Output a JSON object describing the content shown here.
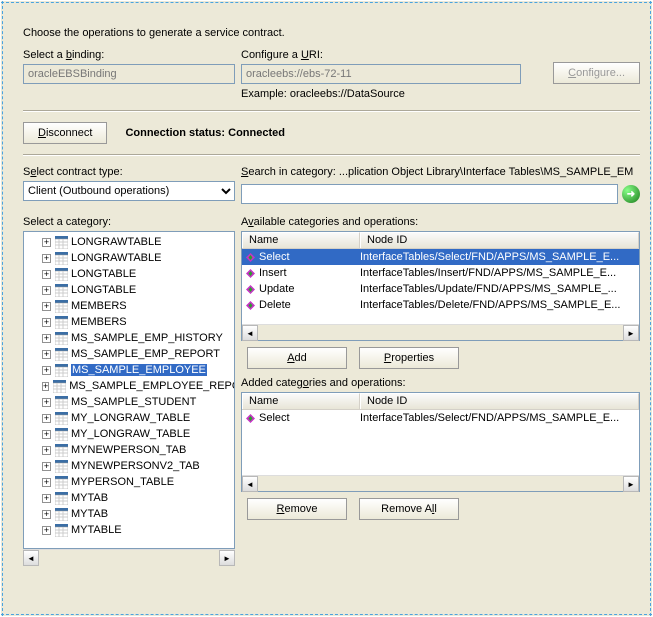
{
  "header": {
    "instruction": "Choose the operations to generate a service contract.",
    "binding_label_pre": "Select a ",
    "binding_label_key": "b",
    "binding_label_post": "inding:",
    "binding_value": "oracleEBSBinding",
    "uri_label_pre": "Configure a ",
    "uri_label_key": "U",
    "uri_label_post": "RI:",
    "uri_value": "oracleebs://ebs-72-11",
    "configure_key": "C",
    "configure_rest": "onfigure...",
    "example": "Example: oracleebs://DataSource"
  },
  "status": {
    "disconnect_key": "D",
    "disconnect_rest": "isconnect",
    "label": "Connection status:",
    "value": "Connected"
  },
  "contract": {
    "label_pre": "S",
    "label_key": "e",
    "label_post": "lect contract type:",
    "value": "Client (Outbound operations)"
  },
  "search": {
    "label_key": "S",
    "label_rest": "earch in category:",
    "path": "...plication Object Library\\Interface Tables\\MS_SAMPLE_EM",
    "value": ""
  },
  "tree": {
    "label_pre": "Select a cate",
    "label_key": "g",
    "label_post": "ory:",
    "items": [
      {
        "label": "LONGRAWTABLE",
        "selected": false
      },
      {
        "label": "LONGRAWTABLE",
        "selected": false
      },
      {
        "label": "LONGTABLE",
        "selected": false
      },
      {
        "label": "LONGTABLE",
        "selected": false
      },
      {
        "label": "MEMBERS",
        "selected": false
      },
      {
        "label": "MEMBERS",
        "selected": false
      },
      {
        "label": "MS_SAMPLE_EMP_HISTORY",
        "selected": false
      },
      {
        "label": "MS_SAMPLE_EMP_REPORT",
        "selected": false
      },
      {
        "label": "MS_SAMPLE_EMPLOYEE",
        "selected": true
      },
      {
        "label": "MS_SAMPLE_EMPLOYEE_REPO",
        "selected": false
      },
      {
        "label": "MS_SAMPLE_STUDENT",
        "selected": false
      },
      {
        "label": "MY_LONGRAW_TABLE",
        "selected": false
      },
      {
        "label": "MY_LONGRAW_TABLE",
        "selected": false
      },
      {
        "label": "MYNEWPERSON_TAB",
        "selected": false
      },
      {
        "label": "MYNEWPERSONV2_TAB",
        "selected": false
      },
      {
        "label": "MYPERSON_TABLE",
        "selected": false
      },
      {
        "label": "MYTAB",
        "selected": false
      },
      {
        "label": "MYTAB",
        "selected": false
      },
      {
        "label": "MYTABLE",
        "selected": false
      }
    ]
  },
  "available": {
    "label_pre": "A",
    "label_key": "v",
    "label_post": "ailable categories and operations:",
    "col_name": "Name",
    "col_node": "Node ID",
    "rows": [
      {
        "name": "Select",
        "node": "InterfaceTables/Select/FND/APPS/MS_SAMPLE_E...",
        "selected": true
      },
      {
        "name": "Insert",
        "node": "InterfaceTables/Insert/FND/APPS/MS_SAMPLE_E...",
        "selected": false
      },
      {
        "name": "Update",
        "node": "InterfaceTables/Update/FND/APPS/MS_SAMPLE_...",
        "selected": false
      },
      {
        "name": "Delete",
        "node": "InterfaceTables/Delete/FND/APPS/MS_SAMPLE_E...",
        "selected": false
      }
    ]
  },
  "added": {
    "label_pre": "Added categ",
    "label_key": "o",
    "label_post": "ries and operations:",
    "col_name": "Name",
    "col_node": "Node ID",
    "rows": [
      {
        "name": "Select",
        "node": "InterfaceTables/Select/FND/APPS/MS_SAMPLE_E...",
        "selected": false
      }
    ]
  },
  "buttons": {
    "add_key": "A",
    "add_rest": "dd",
    "props_key": "P",
    "props_rest": "roperties",
    "remove_key": "R",
    "remove_rest": "emove",
    "removeall_pre": "Remove A",
    "removeall_key": "l",
    "removeall_post": "l"
  }
}
